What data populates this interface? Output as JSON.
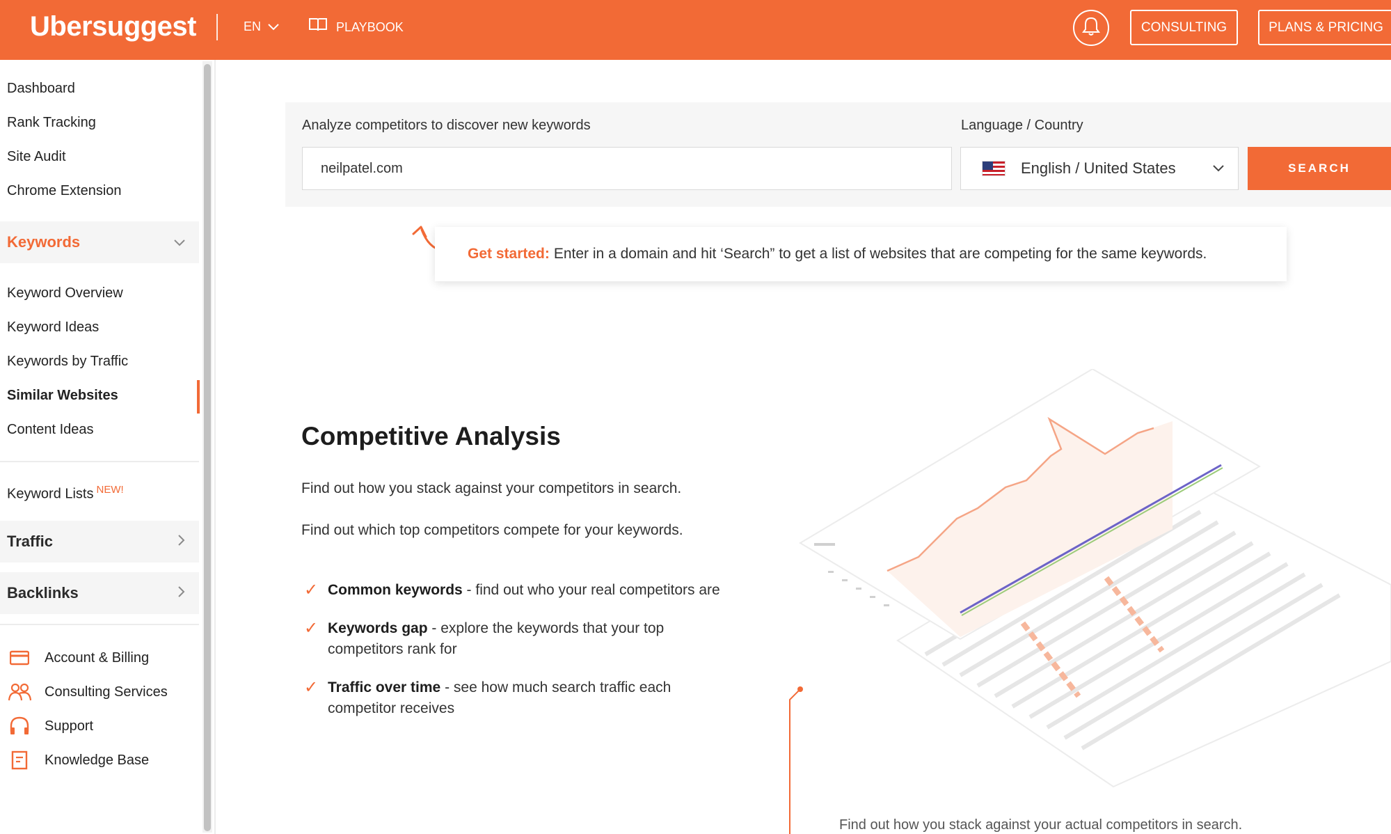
{
  "header": {
    "logo": "Ubersuggest",
    "language": "EN",
    "playbook": "PLAYBOOK",
    "consulting": "CONSULTING",
    "plans": "PLANS & PRICING"
  },
  "sidebar": {
    "top_items": [
      "Dashboard",
      "Rank Tracking",
      "Site Audit",
      "Chrome Extension"
    ],
    "keywords_section": "Keywords",
    "keyword_items": [
      "Keyword Overview",
      "Keyword Ideas",
      "Keywords by Traffic",
      "Similar Websites",
      "Content Ideas"
    ],
    "active_item": "Similar Websites",
    "keyword_lists": "Keyword Lists",
    "new_badge": "NEW!",
    "traffic_section": "Traffic",
    "backlinks_section": "Backlinks",
    "footer_items": [
      {
        "label": "Account & Billing",
        "icon": "credit-card-icon"
      },
      {
        "label": "Consulting Services",
        "icon": "people-icon"
      },
      {
        "label": "Support",
        "icon": "headset-icon"
      },
      {
        "label": "Knowledge Base",
        "icon": "document-icon"
      }
    ]
  },
  "search": {
    "domain_label": "Analyze competitors to discover new keywords",
    "domain_value": "neilpatel.com",
    "locale_label": "Language / Country",
    "locale_value": "English / United States",
    "button": "SEARCH"
  },
  "tip": {
    "strong": "Get started:",
    "text": "Enter in a domain and hit ‘Search” to get a list of websites that are competing for the same keywords."
  },
  "content": {
    "title": "Competitive Analysis",
    "paragraph1": "Find out how you stack against your competitors in search.",
    "paragraph2": "Find out which top competitors compete for your keywords.",
    "bullets": [
      {
        "strong": "Common keywords",
        "text": " - find out who your real competitors are"
      },
      {
        "strong": "Keywords gap",
        "text": " - explore the keywords that your top competitors rank for"
      },
      {
        "strong": "Traffic over time",
        "text": " - see how much search traffic each competitor receives"
      }
    ],
    "caption": "Find out how you stack against your actual competitors in search."
  },
  "colors": {
    "brand": "#f26a36",
    "text": "#2b2b2b"
  }
}
